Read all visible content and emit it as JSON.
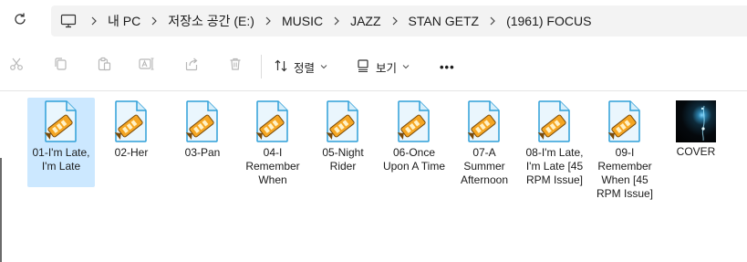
{
  "breadcrumb": {
    "items": [
      "내 PC",
      "저장소 공간 (E:)",
      "MUSIC",
      "JAZZ",
      "STAN GETZ",
      "(1961) FOCUS"
    ]
  },
  "toolbar": {
    "sort_label": "정렬",
    "view_label": "보기",
    "more_label": "•••"
  },
  "files": [
    {
      "name": "01-I'm Late, I'm Late",
      "type": "media",
      "selected": true
    },
    {
      "name": "02-Her",
      "type": "media"
    },
    {
      "name": "03-Pan",
      "type": "media"
    },
    {
      "name": "04-I Remember When",
      "type": "media"
    },
    {
      "name": "05-Night Rider",
      "type": "media"
    },
    {
      "name": "06-Once Upon A Time",
      "type": "media"
    },
    {
      "name": "07-A Summer Afternoon",
      "type": "media"
    },
    {
      "name": "08-I'm Late, I'm Late [45 RPM Issue]",
      "type": "media"
    },
    {
      "name": "09-I Remember When [45 RPM Issue]",
      "type": "media"
    },
    {
      "name": "COVER",
      "type": "image"
    }
  ],
  "colors": {
    "selection": "#cce8ff",
    "address_bg": "#f3f3f3",
    "icon_accent": "#f5a623"
  }
}
